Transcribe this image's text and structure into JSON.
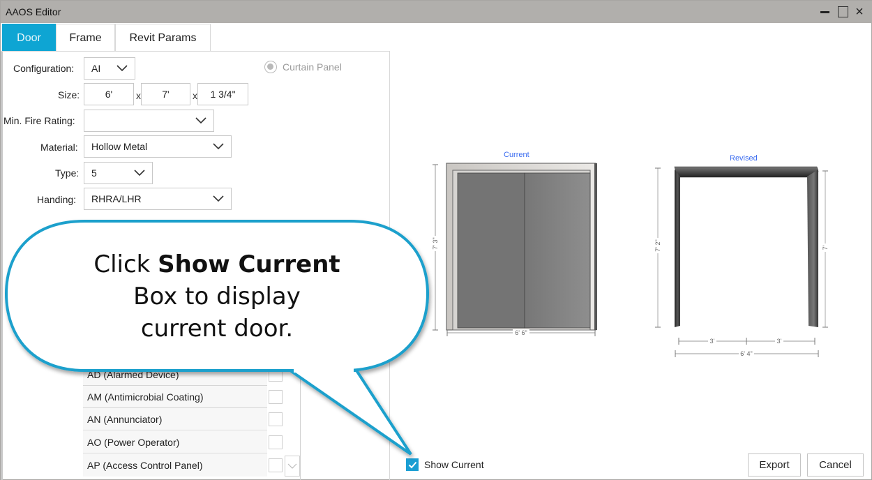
{
  "window": {
    "title": "AAOS Editor",
    "controls": {
      "minimize": "minimize",
      "maximize": "maximize",
      "close": "×"
    }
  },
  "tabs": [
    {
      "label": "Door",
      "active": true
    },
    {
      "label": "Frame",
      "active": false
    },
    {
      "label": "Revit Params",
      "active": false
    }
  ],
  "form": {
    "configuration": {
      "label": "Configuration:",
      "value": "AI"
    },
    "size": {
      "label": "Size:",
      "width": "6'",
      "height": "7'",
      "thickness": "1 3/4\"",
      "separator": "x"
    },
    "min_fire_rating": {
      "label": "Min. Fire Rating:",
      "value": ""
    },
    "material": {
      "label": "Material:",
      "value": "Hollow Metal"
    },
    "type": {
      "label": "Type:",
      "value": "5"
    },
    "handing": {
      "label": "Handing:",
      "value": "RHRA/LHR"
    },
    "curtain_panel": {
      "label": "Curtain Panel",
      "selected": true,
      "enabled": false
    }
  },
  "options_list": [
    {
      "label": "AD (Alarmed Device)",
      "checked": false
    },
    {
      "label": "AM (Antimicrobial Coating)",
      "checked": false
    },
    {
      "label": "AN (Annunciator)",
      "checked": false
    },
    {
      "label": "AO (Power Operator)",
      "checked": false
    },
    {
      "label": "AP (Access Control Panel)",
      "checked": false
    }
  ],
  "preview": {
    "current": {
      "caption": "Current",
      "height_dim": "7' 3\"",
      "width_dim": "6' 6\""
    },
    "revised": {
      "caption": "Revised",
      "outer_height_dim": "7' 2\"",
      "inner_height_dim": "7'",
      "leaf_dims": [
        "3'",
        "3'"
      ],
      "width_dim": "6' 4\""
    }
  },
  "show_current": {
    "label": "Show Current",
    "checked": true
  },
  "buttons": {
    "export": "Export",
    "cancel": "Cancel"
  },
  "callout": {
    "prefix": "Click ",
    "bold": "Show Current",
    "line2": "Box to display",
    "line3": "current door."
  },
  "colors": {
    "accent": "#0ea5d3",
    "callout_border": "#1aa0cc",
    "caption_blue": "#3b6cf0",
    "titlebar": "#b1afac"
  }
}
